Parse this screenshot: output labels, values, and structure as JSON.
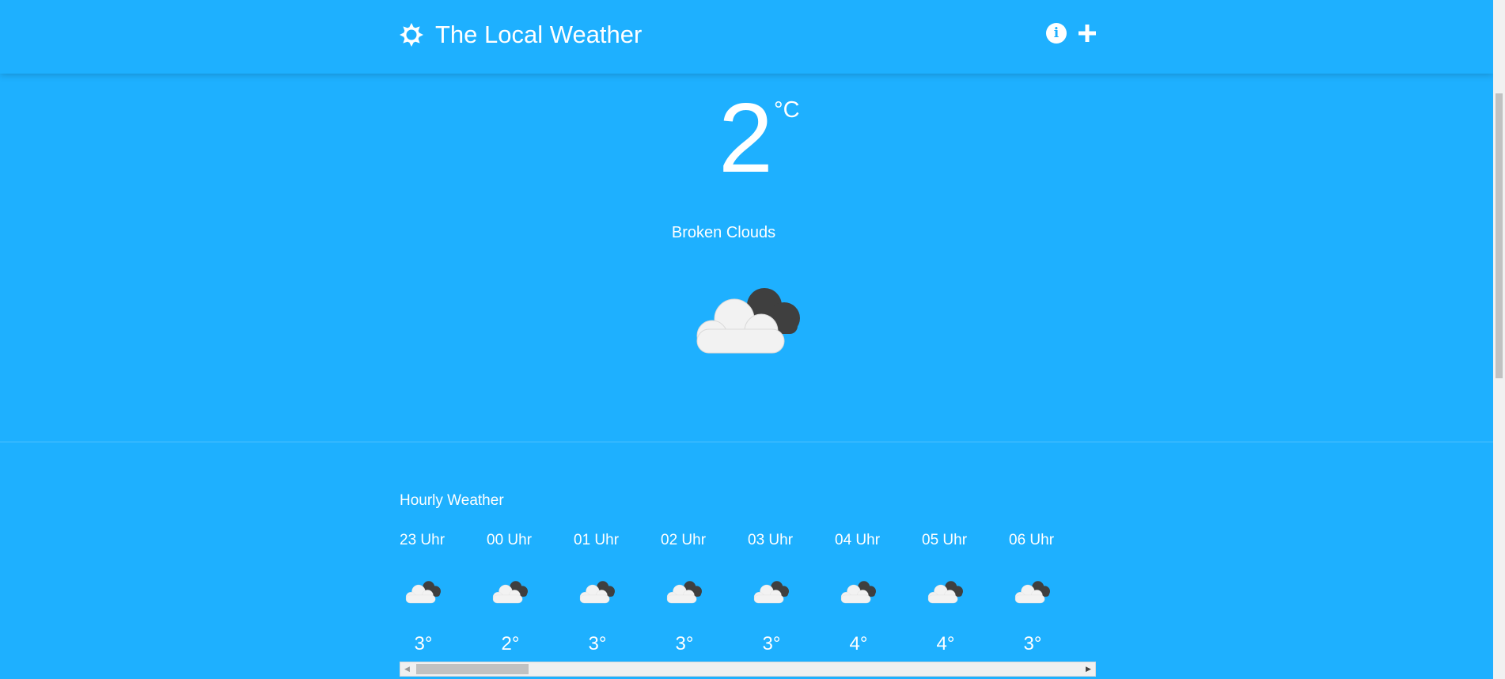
{
  "header": {
    "title": "The Local Weather",
    "brand_icon": "sun-icon",
    "info_icon": "info-icon",
    "add_icon": "plus-icon",
    "info_glyph": "i"
  },
  "current": {
    "temperature": "2",
    "unit": "°C",
    "condition": "Broken Clouds",
    "icon": "broken-clouds-icon"
  },
  "hourly": {
    "title": "Hourly Weather",
    "items": [
      {
        "time": "23 Uhr",
        "icon": "broken-clouds-icon",
        "temp": "3°"
      },
      {
        "time": "00 Uhr",
        "icon": "broken-clouds-icon",
        "temp": "2°"
      },
      {
        "time": "01 Uhr",
        "icon": "broken-clouds-icon",
        "temp": "3°"
      },
      {
        "time": "02 Uhr",
        "icon": "broken-clouds-icon",
        "temp": "3°"
      },
      {
        "time": "03 Uhr",
        "icon": "broken-clouds-icon",
        "temp": "3°"
      },
      {
        "time": "04 Uhr",
        "icon": "broken-clouds-icon",
        "temp": "4°"
      },
      {
        "time": "05 Uhr",
        "icon": "broken-clouds-icon",
        "temp": "4°"
      },
      {
        "time": "06 Uhr",
        "icon": "broken-clouds-icon",
        "temp": "3°"
      }
    ]
  },
  "colors": {
    "background": "#1eb0ff",
    "text": "#ffffff",
    "cloud_light": "#f2f2f2",
    "cloud_dark": "#404040"
  }
}
